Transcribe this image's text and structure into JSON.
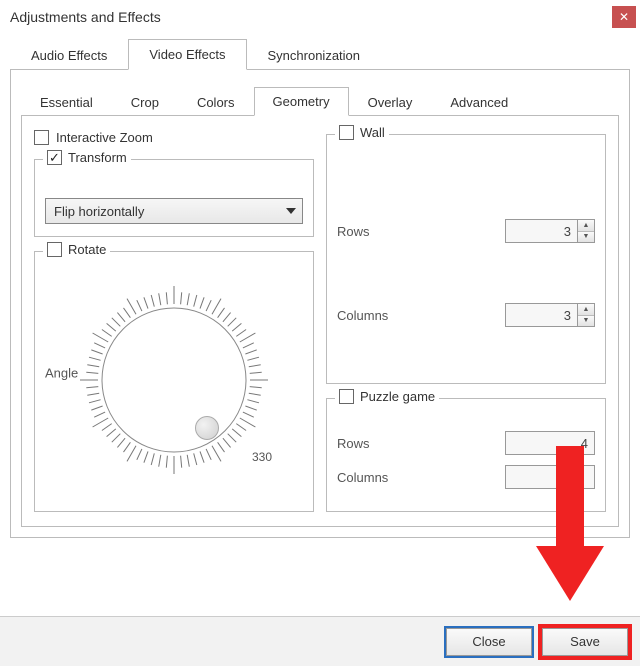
{
  "window": {
    "title": "Adjustments and Effects"
  },
  "tabs": {
    "audio": "Audio Effects",
    "video": "Video Effects",
    "sync": "Synchronization"
  },
  "subtabs": {
    "essential": "Essential",
    "crop": "Crop",
    "colors": "Colors",
    "geometry": "Geometry",
    "overlay": "Overlay",
    "advanced": "Advanced"
  },
  "geometry": {
    "interactive_zoom": "Interactive Zoom",
    "transform": {
      "label": "Transform",
      "value": "Flip horizontally"
    },
    "rotate": {
      "label": "Rotate",
      "angle_label": "Angle",
      "tick_label": "330"
    },
    "wall": {
      "label": "Wall",
      "rows_label": "Rows",
      "rows_value": "3",
      "cols_label": "Columns",
      "cols_value": "3"
    },
    "puzzle": {
      "label": "Puzzle game",
      "rows_label": "Rows",
      "rows_value": "4",
      "cols_label": "Columns",
      "cols_value": ""
    }
  },
  "buttons": {
    "close": "Close",
    "save": "Save"
  }
}
